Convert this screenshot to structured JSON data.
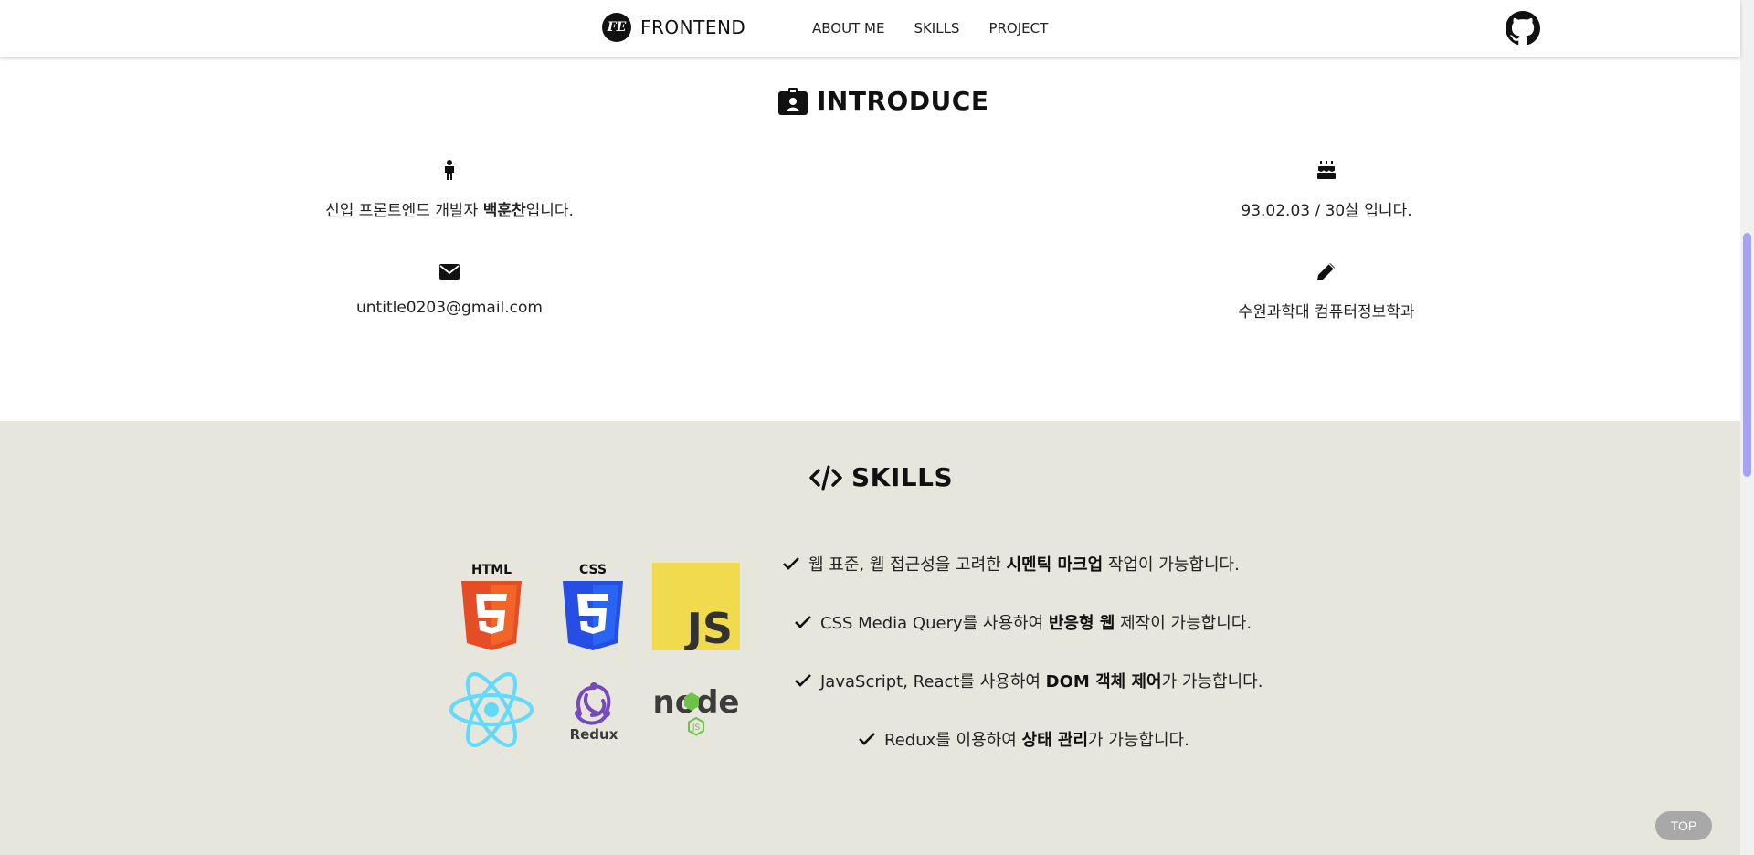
{
  "header": {
    "logo_mark": "FE",
    "logo_text": "FRONTEND",
    "nav": [
      "ABOUT ME",
      "SKILLS",
      "PROJECT"
    ]
  },
  "introduce": {
    "title": "INTRODUCE",
    "name_prefix": "신입 프론트엔드 개발자 ",
    "name": "백훈찬",
    "name_suffix": "입니다.",
    "birth": "93.02.03 / 30살 입니다.",
    "email": "untitle0203@gmail.com",
    "school": "수원과학대 컴퓨터정보학과"
  },
  "skills": {
    "title": "SKILLS",
    "logos": {
      "html": "HTML",
      "css": "CSS",
      "js": "JS",
      "redux": "Redux",
      "node": "node",
      "node_sub": "JS"
    },
    "lines": [
      {
        "pre": "웹 표준, 웹 접근성을 고려한 ",
        "bold": "시멘틱 마크업",
        "post": " 작업이 가능합니다."
      },
      {
        "pre": "CSS Media Query를 사용하여 ",
        "bold": "반응형 웹",
        "post": " 제작이 가능합니다."
      },
      {
        "pre": "JavaScript, React를 사용하여 ",
        "bold": "DOM 객체 제어",
        "post": "가 가능합니다."
      },
      {
        "pre": "Redux를 이용하여 ",
        "bold": "상태 관리",
        "post": "가 가능합니다."
      }
    ]
  },
  "top_button": "TOP",
  "colors": {
    "skills_bg": "#e7e6dc",
    "html": "#e44d26",
    "css": "#264de4",
    "js": "#f0db4f",
    "react": "#61dafb",
    "redux": "#764abc",
    "node": "#3c3c3c",
    "scroll_thumb": "#a5a3f2"
  },
  "icons": [
    "logo-mark",
    "github-icon",
    "id-badge-icon",
    "person-icon",
    "birthday-cake-icon",
    "envelope-icon",
    "pencil-icon",
    "code-icon",
    "check-icon"
  ]
}
